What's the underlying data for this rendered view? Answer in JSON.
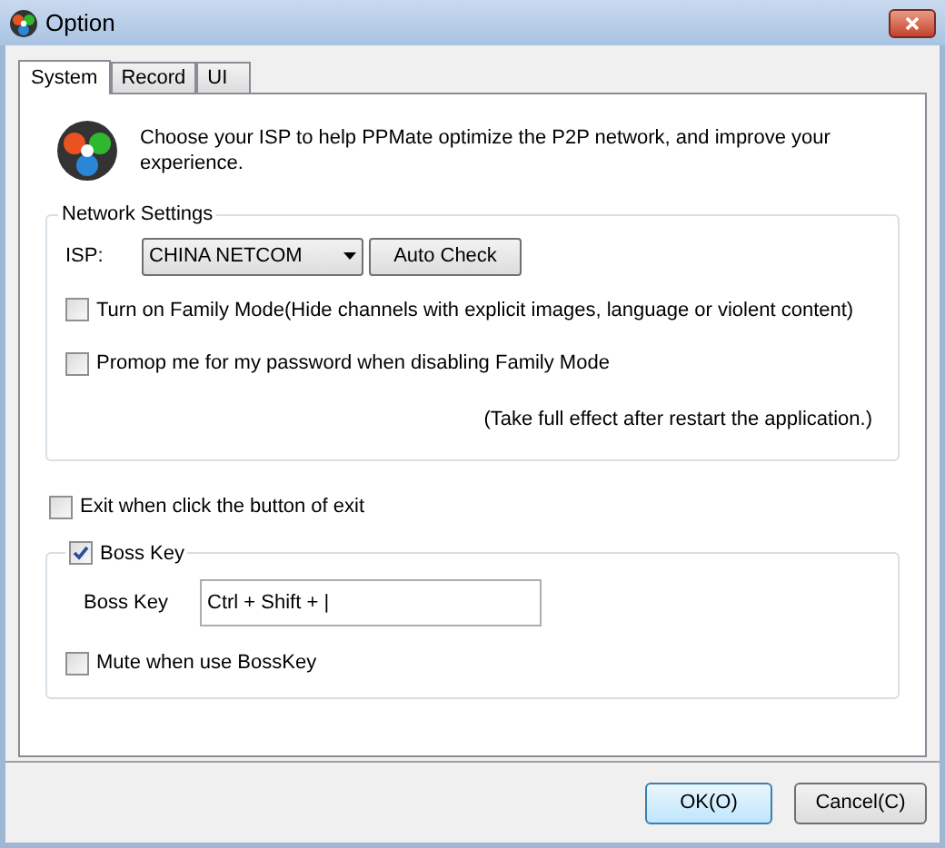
{
  "window": {
    "title": "Option"
  },
  "tabs": [
    {
      "label": "System",
      "selected": true
    },
    {
      "label": "Record",
      "selected": false
    },
    {
      "label": "UI",
      "selected": false
    }
  ],
  "intro": "Choose your ISP to help PPMate optimize the P2P network, and improve your experience.",
  "network": {
    "legend": "Network Settings",
    "isp_label": "ISP:",
    "isp_value": "CHINA NETCOM",
    "auto_check": "Auto Check",
    "options": [
      {
        "label": "Turn on Family Mode(Hide channels with explicit images, language or violent content)",
        "checked": false
      },
      {
        "label": "Promop me for my password when disabling Family Mode",
        "checked": false
      }
    ],
    "note": "(Take full effect after restart the application.)"
  },
  "exit_option": {
    "label": "Exit when click the button of exit",
    "checked": false
  },
  "boss": {
    "legend": "Boss Key",
    "checked": true,
    "key_label": "Boss Key",
    "key_value": "Ctrl + Shift + |",
    "mute": {
      "label": "Mute when use BossKey",
      "checked": false
    }
  },
  "buttons": [
    {
      "label": "OK(O)",
      "selected": true
    },
    {
      "label": "Cancel(C)",
      "selected": false
    }
  ]
}
